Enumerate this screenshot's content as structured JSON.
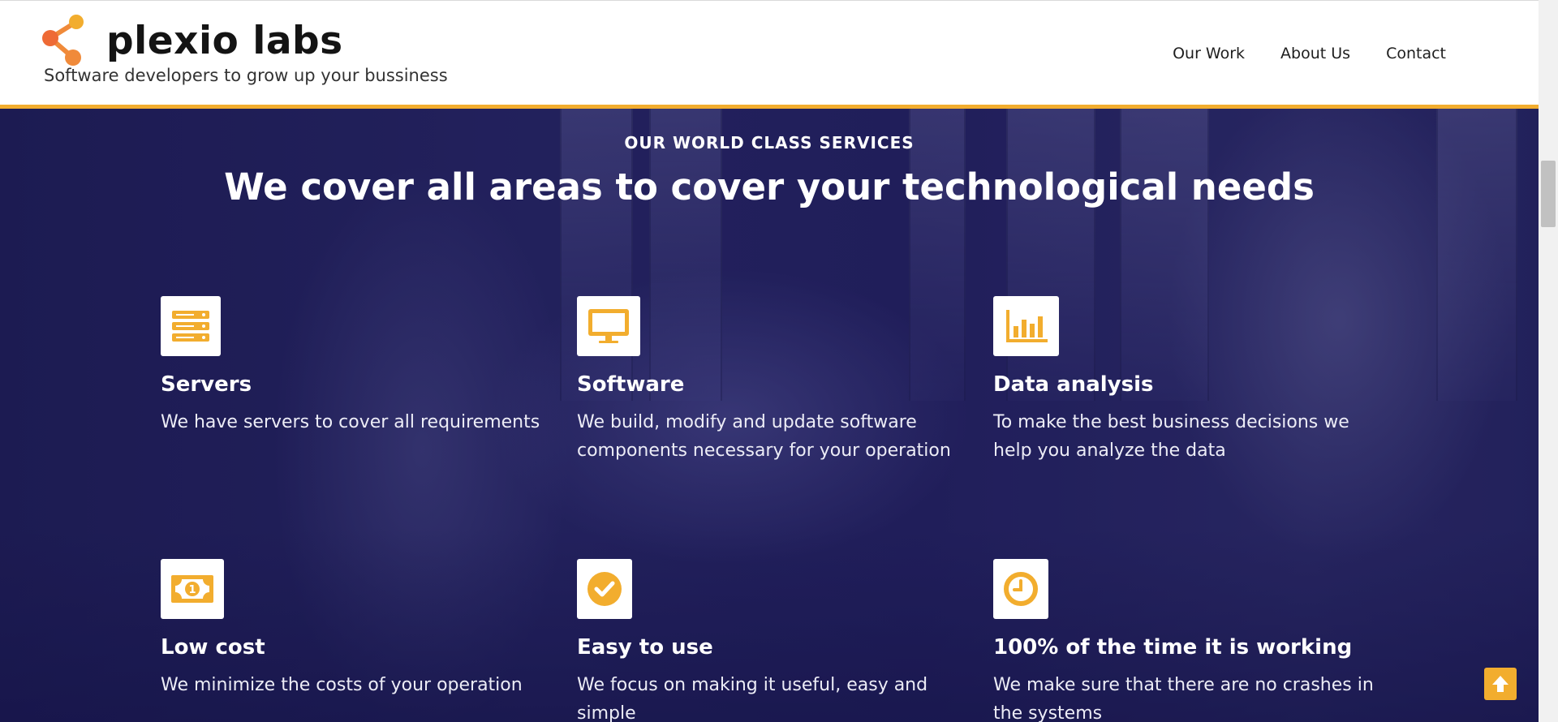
{
  "brand": {
    "name": "plexio labs",
    "tagline": "Software developers to grow up your bussiness",
    "logo_icon": "share-nodes-icon",
    "logo_colors": [
      "#f2ad2e",
      "#ee6a35"
    ]
  },
  "nav": {
    "items": [
      {
        "label": "Our Work"
      },
      {
        "label": "About Us"
      },
      {
        "label": "Contact"
      }
    ]
  },
  "services": {
    "eyebrow": "OUR WORLD CLASS SERVICES",
    "headline": "We cover all areas to cover your technological needs",
    "items": [
      {
        "icon": "server-icon",
        "title": "Servers",
        "description": "We have servers to cover all requirements"
      },
      {
        "icon": "desktop-monitor-icon",
        "title": "Software",
        "description": "We build, modify and update software components necessary for your operation"
      },
      {
        "icon": "bar-chart-icon",
        "title": "Data analysis",
        "description": "To make the best business decisions we help you analyze the data"
      },
      {
        "icon": "money-bill-icon",
        "title": "Low cost",
        "description": "We minimize the costs of your operation"
      },
      {
        "icon": "check-circle-icon",
        "title": "Easy to use",
        "description": "We focus on making it useful, easy and simple"
      },
      {
        "icon": "clock-icon",
        "title": "100% of the time it is working",
        "description": "We make sure that there are no crashes in the systems"
      }
    ]
  },
  "scroll_top": {
    "icon": "arrow-up-icon"
  },
  "colors": {
    "accent": "#f2ad2e",
    "hero_overlay": "#1c1a52",
    "header_bg": "#ffffff"
  }
}
